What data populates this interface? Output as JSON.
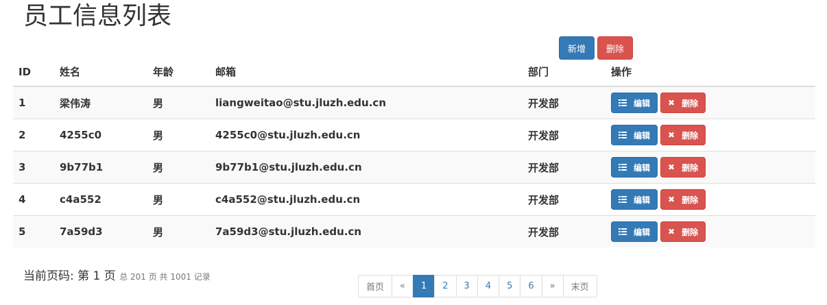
{
  "title": "员工信息列表",
  "actions": {
    "add_label": "新增",
    "delete_label": "删除"
  },
  "table": {
    "headers": [
      "ID",
      "姓名",
      "年龄",
      "邮箱",
      "部门",
      "操作"
    ],
    "rows": [
      {
        "id": "1",
        "name": "梁伟涛",
        "gender": "男",
        "email": "liangweitao@stu.jluzh.edu.cn",
        "dept": "开发部"
      },
      {
        "id": "2",
        "name": "4255c0",
        "gender": "男",
        "email": "4255c0@stu.jluzh.edu.cn",
        "dept": "开发部"
      },
      {
        "id": "3",
        "name": "9b77b1",
        "gender": "男",
        "email": "9b77b1@stu.jluzh.edu.cn",
        "dept": "开发部"
      },
      {
        "id": "4",
        "name": "c4a552",
        "gender": "男",
        "email": "c4a552@stu.jluzh.edu.cn",
        "dept": "开发部"
      },
      {
        "id": "5",
        "name": "7a59d3",
        "gender": "男",
        "email": "7a59d3@stu.jluzh.edu.cn",
        "dept": "开发部"
      }
    ],
    "edit_label": "编辑",
    "delete_label": "删除"
  },
  "page_info": {
    "prefix": "当前页码: 第 1 页",
    "summary": "总 201 页 共 1001 记录"
  },
  "pagination": [
    "首页",
    "«",
    "1",
    "2",
    "3",
    "4",
    "5",
    "6",
    "»",
    "末页"
  ],
  "pagination_active": "1",
  "colors": {
    "primary": "#337ab7",
    "danger": "#d9534f"
  }
}
